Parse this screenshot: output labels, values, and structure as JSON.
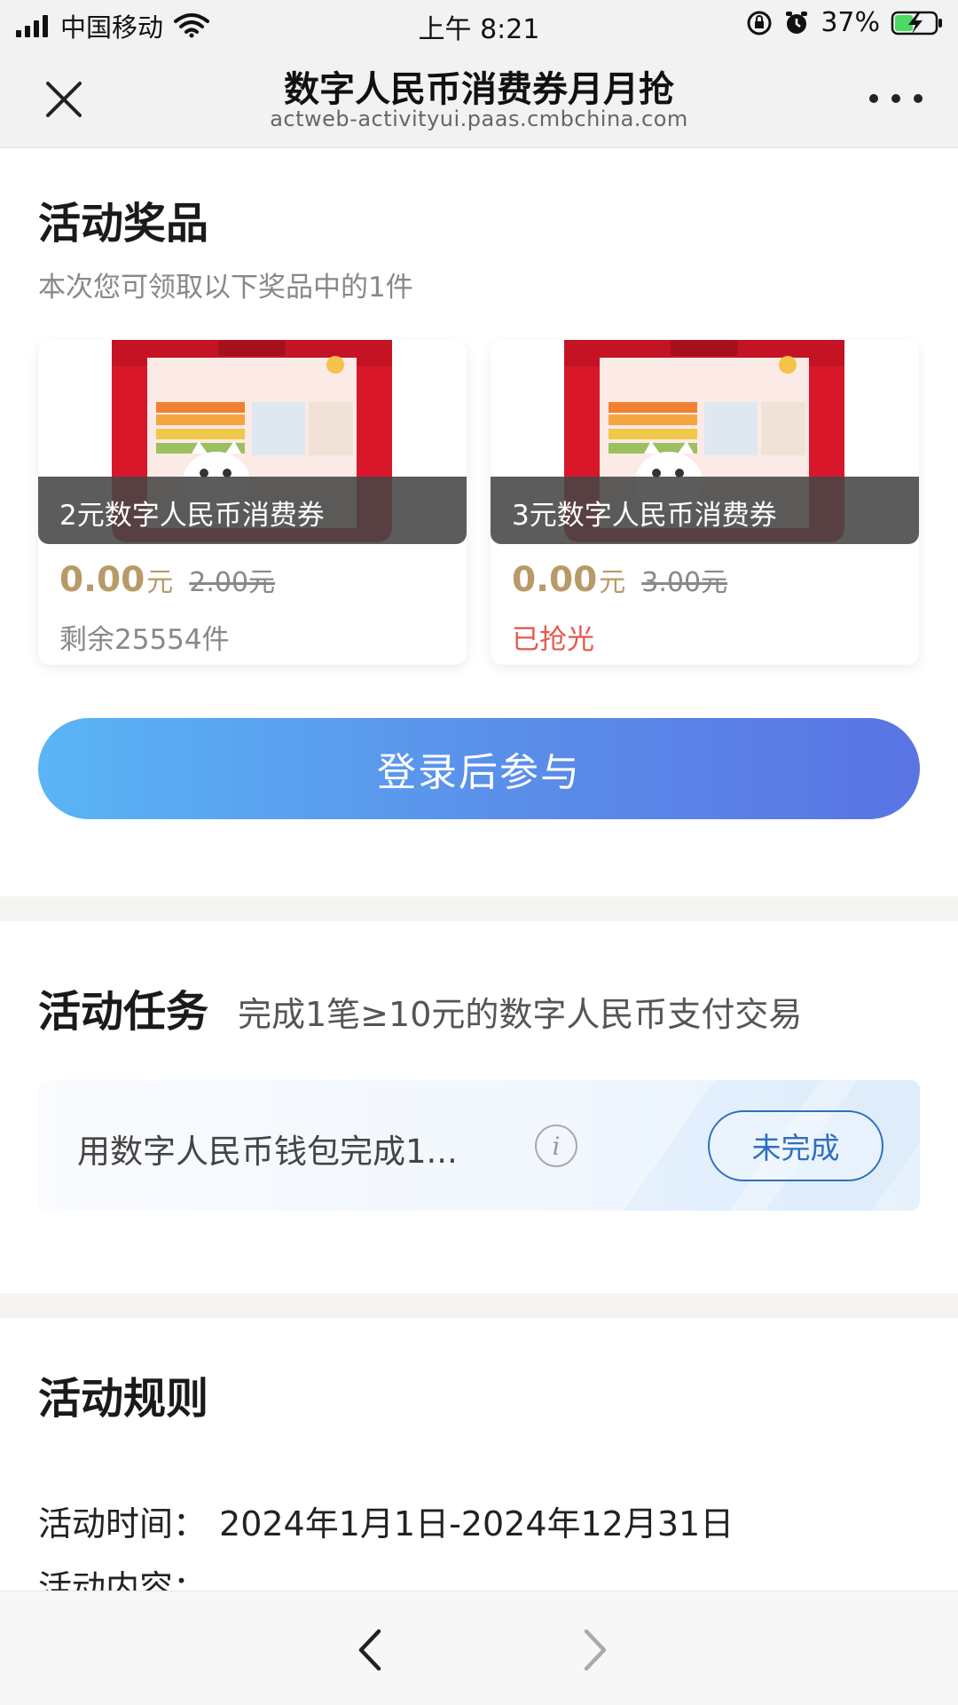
{
  "status_bar": {
    "carrier": "中国移动",
    "time": "上午 8:21",
    "battery": "37%"
  },
  "nav": {
    "title": "数字人民币消费券月月抢",
    "url": "actweb-activityui.paas.cmbchina.com"
  },
  "prizes_section": {
    "title": "活动奖品",
    "subtitle": "本次您可领取以下奖品中的1件",
    "items": [
      {
        "name": "2元数字人民币消费券",
        "price": "0.00",
        "unit": "元",
        "original": "2.00元",
        "stock": "剩余25554件"
      },
      {
        "name": "3元数字人民币消费券",
        "price": "0.00",
        "unit": "元",
        "original": "3.00元",
        "stock": "已抢光"
      }
    ]
  },
  "login_button": "登录后参与",
  "task_section": {
    "title": "活动任务",
    "description": "完成1笔≥10元的数字人民币支付交易",
    "task_text": "用数字人民币钱包完成1...",
    "status": "未完成"
  },
  "rules_section": {
    "title": "活动规则",
    "time_label": "活动时间：",
    "time_value": "2024年1月1日-2024年12月31日",
    "content_label": "活动内容："
  },
  "colors": {
    "accent_gold": "#b89a68",
    "sold_out_red": "#e25a50",
    "status_blue": "#2f6fbf",
    "button_gradient_start": "#5ab5f5",
    "button_gradient_end": "#5a74e4"
  }
}
